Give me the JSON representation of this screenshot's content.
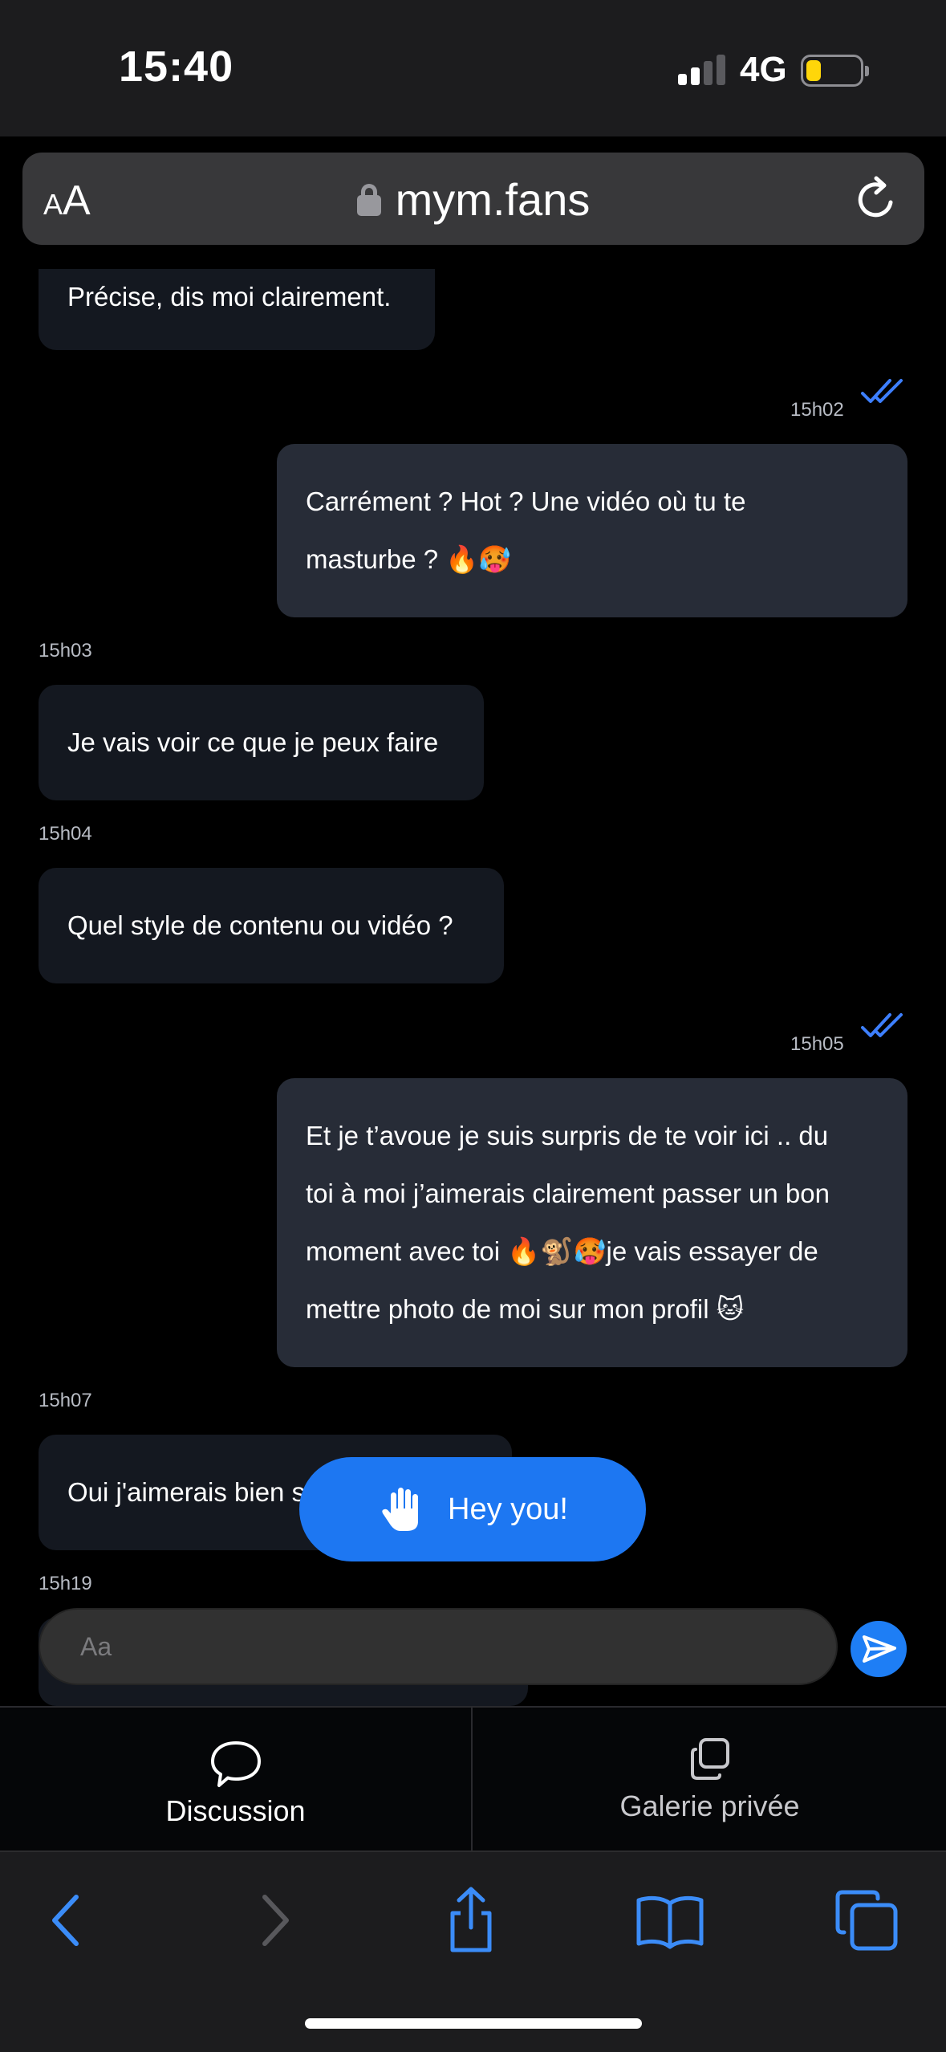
{
  "status": {
    "time": "15:40",
    "network": "4G"
  },
  "browser": {
    "text_size_label_small": "A",
    "text_size_label_large": "A",
    "url": "mym.fans"
  },
  "chat": {
    "messages": [
      {
        "direction": "in",
        "text": "Précise, dis moi clairement."
      },
      {
        "direction": "out",
        "time": "15h02",
        "lines": [
          "Carrément ? Hot ? Une vidéo où tu te",
          "masturbe ? 🔥🥵"
        ]
      },
      {
        "direction": "in",
        "time": "15h03",
        "text": "Je vais voir ce que je peux faire"
      },
      {
        "direction": "in",
        "time": "15h04",
        "text": "Quel style de contenu ou vidéo ?"
      },
      {
        "direction": "out",
        "time": "15h05",
        "lines": [
          "Et je t’avoue je suis surpris de te voir ici .. du",
          "toi à moi j’aimerais clairement passer un bon",
          "moment avec toi 🔥🐒🥵je vais essayer de",
          "mettre photo de moi sur mon profil 🐱"
        ]
      },
      {
        "direction": "in",
        "time": "15h07",
        "text": "Oui j'aimerais bien s"
      },
      {
        "direction": "in",
        "time": "15h19"
      }
    ],
    "input_placeholder": "Aa",
    "toast": "Hey you!"
  },
  "tabs": [
    {
      "label": "Discussion",
      "icon": "speech-bubble-icon",
      "active": true
    },
    {
      "label": "Galerie privée",
      "icon": "gallery-icon",
      "active": false
    }
  ],
  "toolbar": {
    "icons": [
      "back-icon",
      "forward-icon",
      "share-icon",
      "bookmarks-icon",
      "tabs-icon"
    ]
  },
  "colors": {
    "accent": "#1e7ef5",
    "bubble_in": "#141820",
    "bubble_out": "#272c37",
    "battery": "#ffd60a"
  }
}
